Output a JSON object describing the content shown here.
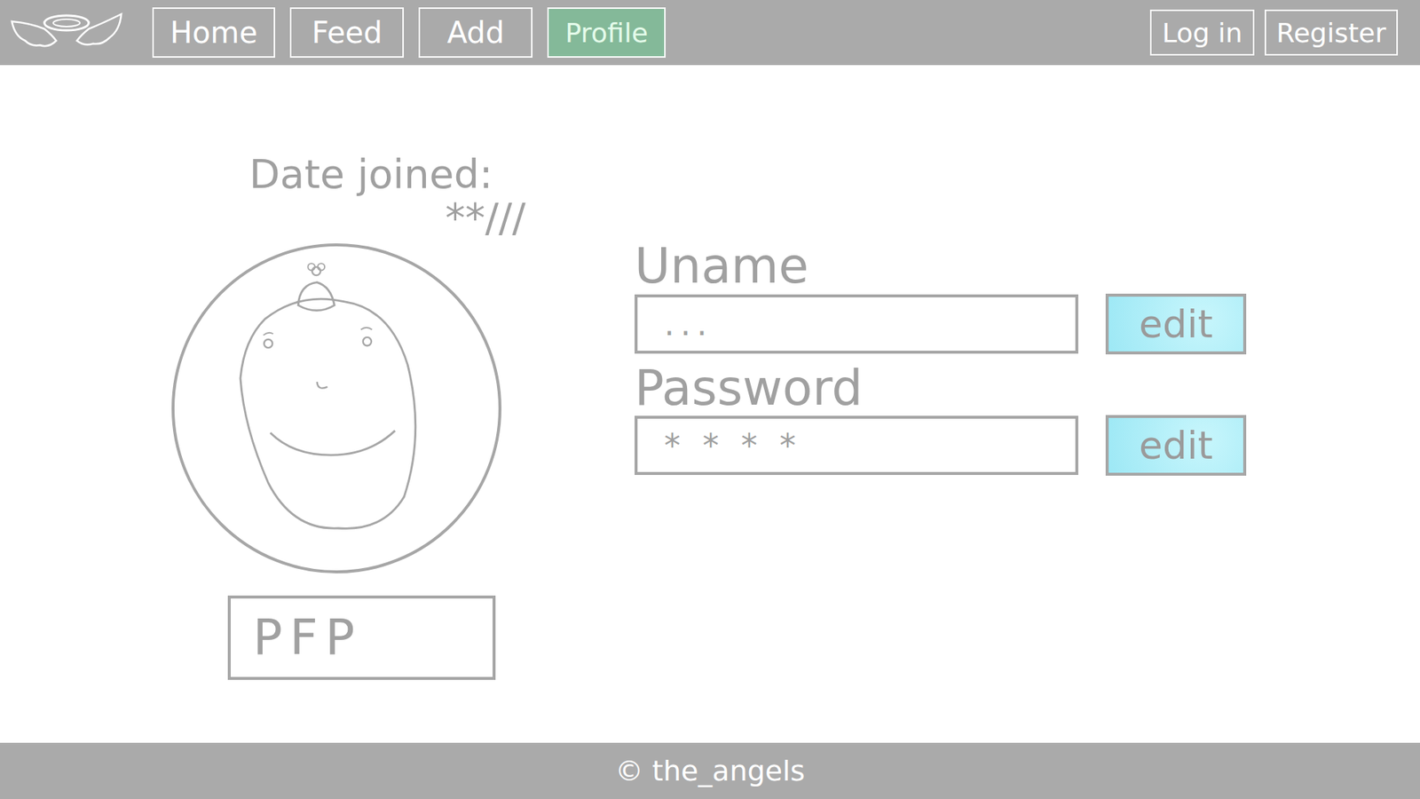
{
  "nav": [
    {
      "label": "Home",
      "selected": false
    },
    {
      "label": "Feed",
      "selected": false
    },
    {
      "label": "Add",
      "selected": false
    },
    {
      "label": "Profile",
      "selected": true
    }
  ],
  "auth": [
    "Log in",
    "Register"
  ],
  "profile": {
    "date_label": "Date joined:",
    "date_value": "**///",
    "avatar_button": "PFP"
  },
  "fields": [
    {
      "label": "Uname",
      "value": "...",
      "button": "edit"
    },
    {
      "label": "Password",
      "value": "* * * *",
      "button": "edit"
    }
  ],
  "footer": "© the_angels"
}
